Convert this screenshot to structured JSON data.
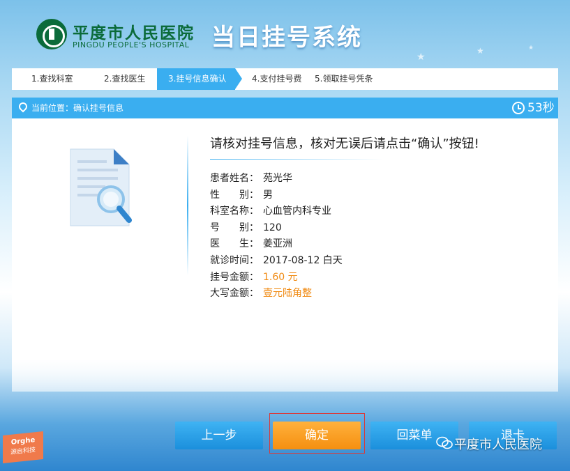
{
  "header": {
    "hospital_name": "平度市人民医院",
    "hospital_name_en": "PINGDU PEOPLE'S HOSPITAL",
    "system_title": "当日挂号系统"
  },
  "steps": [
    {
      "label": "1.查找科室"
    },
    {
      "label": "2.查找医生"
    },
    {
      "label": "3.挂号信息确认",
      "active": true
    },
    {
      "label": "4.支付挂号费"
    },
    {
      "label": "5.领取挂号凭条"
    }
  ],
  "location": {
    "label": "当前位置：",
    "value": "确认挂号信息",
    "timer": "53秒"
  },
  "confirm": {
    "headline": "请核对挂号信息，核对无误后请点击“确认”按钮!",
    "fields": [
      {
        "key": "患者姓名：",
        "value": "苑光华"
      },
      {
        "key": "性　　别：",
        "value": "男"
      },
      {
        "key": "科室名称：",
        "value": "心血管内科专业"
      },
      {
        "key": "号　　别：",
        "value": "120"
      },
      {
        "key": "医　　生：",
        "value": "姜亚洲"
      },
      {
        "key": "就诊时间：",
        "value": "2017-08-12 白天"
      },
      {
        "key": "挂号金额：",
        "value": "1.60 元",
        "highlight": true
      },
      {
        "key": "大写金额：",
        "value": "壹元陆角整",
        "highlight": true
      }
    ]
  },
  "buttons": {
    "prev": "上一步",
    "confirm": "确定",
    "menu": "回菜单",
    "exit": "退卡"
  },
  "badge": {
    "line1": "Orghe",
    "line2": "源启科技"
  },
  "watermark": "平度市人民医院",
  "colors": {
    "primary_blue": "#3aaef0",
    "confirm_orange": "#f58f10",
    "amount_orange": "#f08a12",
    "logo_green": "#0b6b3a"
  }
}
